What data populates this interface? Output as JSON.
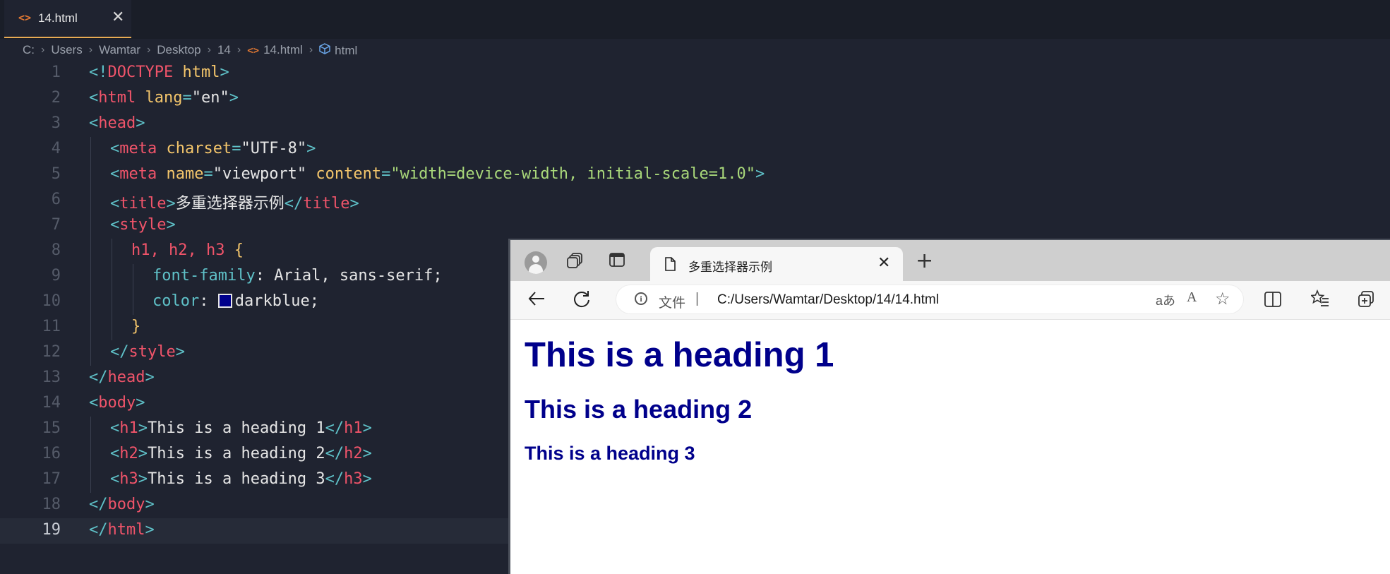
{
  "editor": {
    "tab": {
      "label": "14.html",
      "close": "✕",
      "icon": "html-file-icon"
    },
    "breadcrumb": [
      "C:",
      "Users",
      "Wamtar",
      "Desktop",
      "14",
      "14.html",
      "html"
    ],
    "lines": [
      "1",
      "2",
      "3",
      "4",
      "5",
      "6",
      "7",
      "8",
      "9",
      "10",
      "11",
      "12",
      "13",
      "14",
      "15",
      "16",
      "17",
      "18",
      "19"
    ],
    "code": {
      "l1_tag": "DOCTYPE",
      "l1_attr": "html",
      "l2_tag": "html",
      "l2_attr": "lang",
      "l2_val": "\"en\"",
      "l3_tag": "head",
      "l4_tag": "meta",
      "l4_attr": "charset",
      "l4_val": "\"UTF-8\"",
      "l5_tag": "meta",
      "l5_attr1": "name",
      "l5_val1": "\"viewport\"",
      "l5_attr2": "content",
      "l5_val2": "\"width=device-width, initial-scale=1.0\"",
      "l6_tag": "title",
      "l6_text": "多重选择器示例",
      "l7_tag": "style",
      "l8_sel": "h1, h2, h3",
      "l8_brace": "{",
      "l9_prop": "font-family",
      "l9_val": " Arial, sans-serif;",
      "l10_prop": "color",
      "l10_val": "darkblue;",
      "l11_brace": "}",
      "l12_tag": "style",
      "l13_tag": "head",
      "l14_tag": "body",
      "l15_tag": "h1",
      "l15_text": "This is a heading 1",
      "l16_tag": "h2",
      "l16_text": "This is a heading 2",
      "l17_tag": "h3",
      "l17_text": "This is a heading 3",
      "l18_tag": "body",
      "l19_tag": "html"
    },
    "swatch_color": "#00008b"
  },
  "browser": {
    "tab_title": "多重选择器示例",
    "tab_close": "✕",
    "new_tab": "+",
    "site_label": "文件",
    "addr_sep": "|",
    "url": "C:/Users/Wamtar/Desktop/14/14.html",
    "translate": "aあ",
    "readaloud": "A",
    "favorite": "☆",
    "info": "i"
  },
  "page": {
    "h1": "This is a heading 1",
    "h2": "This is a heading 2",
    "h3": "This is a heading 3",
    "heading_color": "#00008b"
  }
}
